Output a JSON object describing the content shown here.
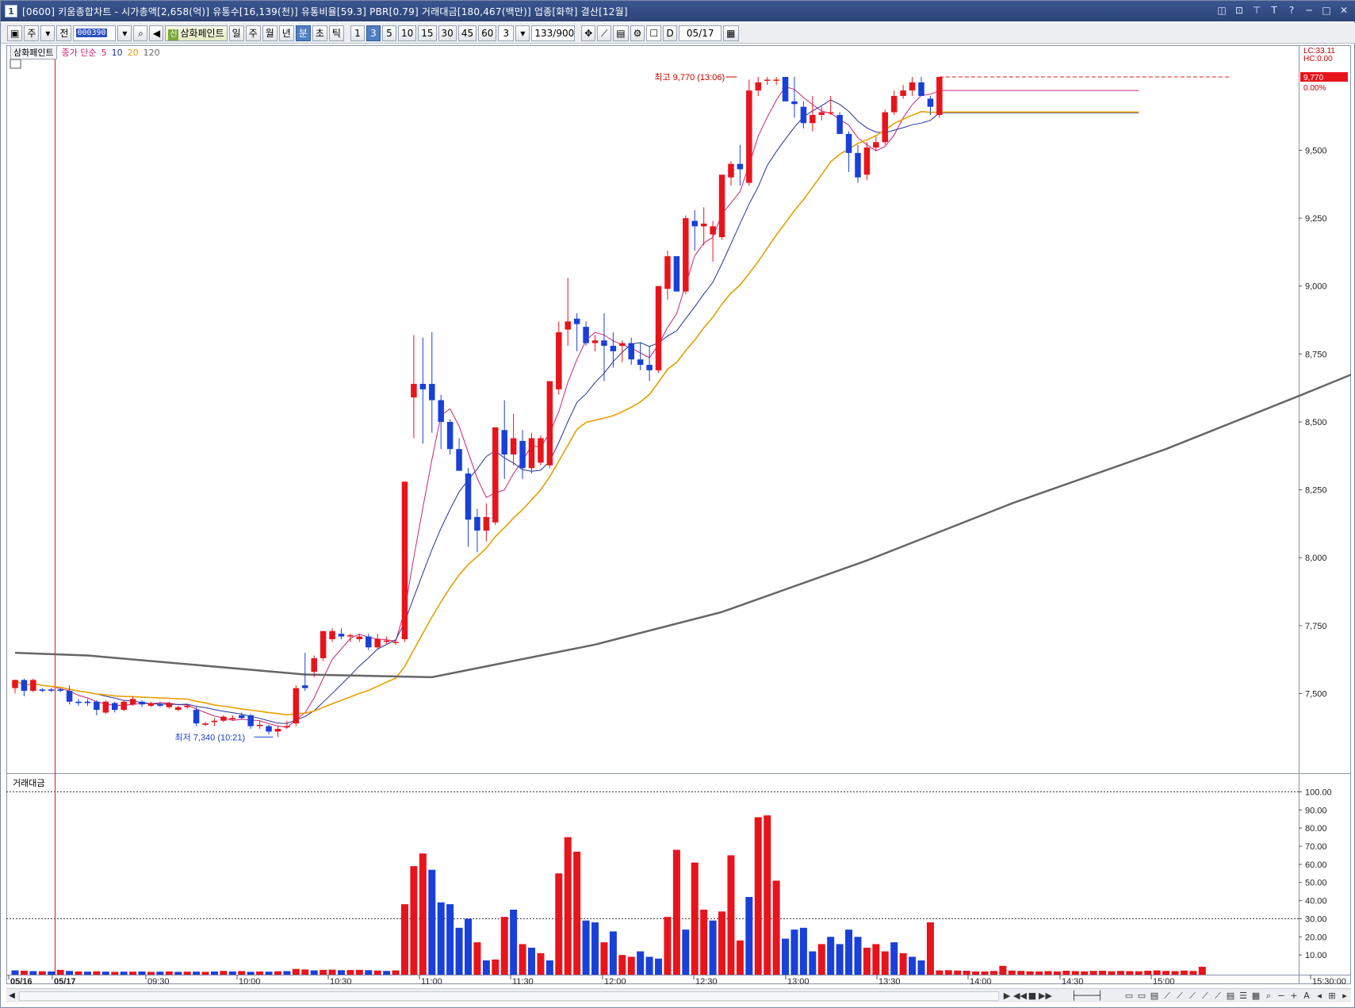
{
  "window": {
    "number": "1",
    "title": "[0600] 키움종합차트 - 시가총액[2,658(억)] 유통수[16,139(천)] 유통비율[59.3] PBR[0.79] 거래대금[180,467(백만)] 업종[화학] 결산[12월]",
    "controls": [
      "◫",
      "⊡",
      "⊤",
      "T",
      "?",
      "─",
      "□",
      "✕"
    ]
  },
  "toolbar": {
    "market": "주",
    "whole": "전",
    "code": "000390",
    "stock_name": "삼화페인트",
    "stock_badge": "신",
    "periods": [
      "일",
      "주",
      "월",
      "년",
      "분",
      "초",
      "틱"
    ],
    "active_period": "분",
    "minutes": [
      "1",
      "3",
      "5",
      "10",
      "15",
      "30",
      "45",
      "60"
    ],
    "active_minute": "3",
    "interval": "3",
    "count": "133",
    "count_max": "/900",
    "date_toggle": "D",
    "date": "05/17"
  },
  "price_panel": {
    "name": "삼화페인트",
    "ma_label": "종가 단순",
    "ma_periods": [
      "5",
      "10",
      "20",
      "120"
    ],
    "ma_colors": [
      "#cc2277",
      "#223399",
      "#e8a000",
      "#666666"
    ],
    "lc_label": "LC:33.11",
    "hc_label": "HC:0.00",
    "last_price": "9,770",
    "last_change": "0.00%",
    "high_label": "최고 9,770 (13:06)",
    "low_label": "최저 7,340 (10:21)",
    "y_ticks": [
      "9,500",
      "9,250",
      "9,000",
      "8,750",
      "8,500",
      "8,250",
      "8,000",
      "7,750",
      "7,500"
    ]
  },
  "volume_panel": {
    "name": "거래대금",
    "y_ticks": [
      "100.00",
      "90.00",
      "80.00",
      "70.00",
      "60.00",
      "50.00",
      "40.00",
      "30.00",
      "20.00",
      "10.00"
    ]
  },
  "x_axis": {
    "labels": [
      "05/16",
      "05/17",
      "09:30",
      "10:00",
      "10:30",
      "11:00",
      "11:30",
      "12:00",
      "12:30",
      "13:00",
      "13:30",
      "14:00",
      "14:30",
      "15:00",
      "15:30:00"
    ]
  },
  "colors": {
    "up": "#e8141c",
    "down": "#1940d8",
    "ma5": "#cc2277",
    "ma10": "#223399",
    "ma20": "#e8a000",
    "ma120": "#666666"
  },
  "chart_data": {
    "type": "candlestick",
    "interval_minutes": 3,
    "x_labels": [
      "05/16",
      "05/17",
      "09:30",
      "10:00",
      "10:30",
      "11:00",
      "11:30",
      "12:00",
      "12:30",
      "13:00",
      "13:30",
      "14:00",
      "14:30",
      "15:00",
      "15:30:00"
    ],
    "y_range": [
      7300,
      9770
    ],
    "candles": [
      [
        7520,
        7550,
        7500,
        7550
      ],
      [
        7550,
        7555,
        7490,
        7510
      ],
      [
        7510,
        7555,
        7505,
        7550
      ],
      [
        7515,
        7520,
        7505,
        7510
      ],
      [
        7515,
        7520,
        7505,
        7510
      ],
      [
        7515,
        7520,
        7505,
        7510
      ],
      [
        7510,
        7530,
        7460,
        7470
      ],
      [
        7470,
        7480,
        7455,
        7465
      ],
      [
        7470,
        7480,
        7455,
        7465
      ],
      [
        7470,
        7475,
        7420,
        7440
      ],
      [
        7430,
        7475,
        7425,
        7470
      ],
      [
        7465,
        7470,
        7430,
        7440
      ],
      [
        7440,
        7475,
        7435,
        7470
      ],
      [
        7460,
        7490,
        7455,
        7480
      ],
      [
        7470,
        7475,
        7450,
        7460
      ],
      [
        7455,
        7470,
        7450,
        7465
      ],
      [
        7460,
        7470,
        7450,
        7455
      ],
      [
        7450,
        7470,
        7445,
        7465
      ],
      [
        7440,
        7455,
        7435,
        7450
      ],
      [
        7450,
        7460,
        7445,
        7455
      ],
      [
        7440,
        7450,
        7380,
        7390
      ],
      [
        7385,
        7395,
        7380,
        7390
      ],
      [
        7395,
        7410,
        7380,
        7400
      ],
      [
        7400,
        7420,
        7395,
        7415
      ],
      [
        7405,
        7420,
        7400,
        7410
      ],
      [
        7420,
        7430,
        7405,
        7410
      ],
      [
        7420,
        7425,
        7370,
        7380
      ],
      [
        7380,
        7400,
        7370,
        7385
      ],
      [
        7380,
        7385,
        7350,
        7360
      ],
      [
        7360,
        7380,
        7340,
        7370
      ],
      [
        7380,
        7400,
        7370,
        7380
      ],
      [
        7390,
        7530,
        7380,
        7520
      ],
      [
        7530,
        7650,
        7510,
        7520
      ],
      [
        7580,
        7640,
        7560,
        7630
      ],
      [
        7630,
        7720,
        7620,
        7730
      ],
      [
        7700,
        7740,
        7690,
        7730
      ],
      [
        7720,
        7740,
        7700,
        7710
      ],
      [
        7710,
        7720,
        7690,
        7715
      ],
      [
        7700,
        7720,
        7690,
        7710
      ],
      [
        7710,
        7720,
        7660,
        7670
      ],
      [
        7670,
        7720,
        7665,
        7700
      ],
      [
        7690,
        7710,
        7680,
        7695
      ],
      [
        7690,
        7700,
        7680,
        7690
      ],
      [
        7700,
        8280,
        7690,
        8280
      ],
      [
        8590,
        8820,
        8440,
        8640
      ],
      [
        8640,
        8810,
        8420,
        8620
      ],
      [
        8640,
        8830,
        8460,
        8580
      ],
      [
        8580,
        8600,
        8400,
        8500
      ],
      [
        8500,
        8510,
        8380,
        8400
      ],
      [
        8400,
        8440,
        8320,
        8320
      ],
      [
        8310,
        8330,
        8040,
        8140
      ],
      [
        8150,
        8180,
        8020,
        8100
      ],
      [
        8100,
        8200,
        8060,
        8150
      ],
      [
        8130,
        8480,
        8120,
        8480
      ],
      [
        8470,
        8580,
        8290,
        8380
      ],
      [
        8380,
        8530,
        8340,
        8440
      ],
      [
        8430,
        8470,
        8290,
        8330
      ],
      [
        8330,
        8460,
        8310,
        8440
      ],
      [
        8350,
        8450,
        8340,
        8440
      ],
      [
        8340,
        8640,
        8330,
        8650
      ],
      [
        8620,
        8870,
        8600,
        8830
      ],
      [
        8840,
        9030,
        8780,
        8870
      ],
      [
        8880,
        8900,
        8760,
        8860
      ],
      [
        8850,
        8870,
        8780,
        8790
      ],
      [
        8790,
        8820,
        8760,
        8800
      ],
      [
        8800,
        8900,
        8650,
        8780
      ],
      [
        8780,
        8830,
        8700,
        8760
      ],
      [
        8780,
        8800,
        8720,
        8790
      ],
      [
        8790,
        8810,
        8710,
        8730
      ],
      [
        8730,
        8790,
        8690,
        8710
      ],
      [
        8710,
        8780,
        8650,
        8690
      ],
      [
        8690,
        9000,
        8680,
        9000
      ],
      [
        8990,
        9130,
        8950,
        9110
      ],
      [
        9110,
        9070,
        8980,
        8980
      ],
      [
        8980,
        9260,
        8970,
        9250
      ],
      [
        9240,
        9280,
        9130,
        9220
      ],
      [
        9220,
        9290,
        9150,
        9230
      ],
      [
        9190,
        9240,
        9090,
        9220
      ],
      [
        9180,
        9410,
        9170,
        9410
      ],
      [
        9400,
        9460,
        9370,
        9450
      ],
      [
        9450,
        9520,
        9370,
        9430
      ],
      [
        9380,
        9760,
        9370,
        9720
      ],
      [
        9720,
        9770,
        9700,
        9750
      ],
      [
        9760,
        9770,
        9740,
        9760
      ],
      [
        9760,
        9770,
        9740,
        9760
      ],
      [
        9770,
        9770,
        9680,
        9680
      ],
      [
        9680,
        9770,
        9620,
        9670
      ],
      [
        9660,
        9680,
        9580,
        9600
      ],
      [
        9600,
        9700,
        9570,
        9630
      ],
      [
        9630,
        9660,
        9610,
        9640
      ],
      [
        9640,
        9700,
        9630,
        9640
      ],
      [
        9630,
        9640,
        9560,
        9560
      ],
      [
        9560,
        9570,
        9420,
        9490
      ],
      [
        9490,
        9520,
        9380,
        9400
      ],
      [
        9410,
        9530,
        9390,
        9510
      ],
      [
        9510,
        9550,
        9500,
        9530
      ],
      [
        9530,
        9650,
        9520,
        9640
      ],
      [
        9640,
        9720,
        9630,
        9700
      ],
      [
        9700,
        9740,
        9690,
        9720
      ],
      [
        9720,
        9770,
        9700,
        9750
      ],
      [
        9750,
        9770,
        9700,
        9700
      ],
      [
        9690,
        9700,
        9630,
        9660
      ],
      [
        9630,
        9770,
        9620,
        9770
      ]
    ],
    "ma120": [
      [
        0,
        7650
      ],
      [
        8,
        7640
      ],
      [
        32,
        7570
      ],
      [
        46,
        7560
      ],
      [
        58,
        7640
      ],
      [
        64,
        7680
      ],
      [
        78,
        7800
      ],
      [
        94,
        7990
      ],
      [
        110,
        8200
      ],
      [
        127,
        8400
      ],
      [
        142,
        8600
      ],
      [
        153,
        8750
      ]
    ],
    "volume": [
      [
        0,
        1.5,
        "down"
      ],
      [
        1,
        1.3,
        "up"
      ],
      [
        2,
        1.1,
        "down"
      ],
      [
        3,
        1.0,
        "up"
      ],
      [
        4,
        0.9,
        "down"
      ],
      [
        5,
        1.8,
        "up"
      ],
      [
        6,
        1.2,
        "down"
      ],
      [
        7,
        0.9,
        "up"
      ],
      [
        8,
        0.8,
        "down"
      ],
      [
        9,
        1.0,
        "up"
      ],
      [
        10,
        0.8,
        "down"
      ],
      [
        11,
        0.7,
        "up"
      ],
      [
        12,
        0.8,
        "down"
      ],
      [
        13,
        0.8,
        "up"
      ],
      [
        14,
        0.9,
        "down"
      ],
      [
        15,
        0.7,
        "up"
      ],
      [
        16,
        0.8,
        "down"
      ],
      [
        17,
        0.9,
        "up"
      ],
      [
        18,
        0.7,
        "down"
      ],
      [
        19,
        0.8,
        "up"
      ],
      [
        20,
        0.8,
        "down"
      ],
      [
        21,
        0.7,
        "up"
      ],
      [
        22,
        0.9,
        "down"
      ],
      [
        23,
        1.2,
        "up"
      ],
      [
        24,
        0.9,
        "down"
      ],
      [
        25,
        1.1,
        "up"
      ],
      [
        26,
        0.7,
        "down"
      ],
      [
        27,
        0.9,
        "up"
      ],
      [
        28,
        0.8,
        "down"
      ],
      [
        29,
        1.0,
        "up"
      ],
      [
        30,
        1.1,
        "down"
      ],
      [
        31,
        2.3,
        "up"
      ],
      [
        32,
        2.0,
        "up"
      ],
      [
        33,
        1.5,
        "down"
      ],
      [
        34,
        1.8,
        "up"
      ],
      [
        35,
        1.9,
        "up"
      ],
      [
        36,
        1.6,
        "down"
      ],
      [
        37,
        1.7,
        "up"
      ],
      [
        38,
        1.8,
        "up"
      ],
      [
        39,
        1.6,
        "down"
      ],
      [
        40,
        1.4,
        "up"
      ],
      [
        41,
        1.2,
        "down"
      ],
      [
        42,
        1.5,
        "up"
      ],
      [
        43,
        38.0,
        "up"
      ],
      [
        44,
        59.0,
        "up"
      ],
      [
        45,
        66.0,
        "up"
      ],
      [
        46,
        57.0,
        "down"
      ],
      [
        47,
        39.0,
        "down"
      ],
      [
        48,
        38.0,
        "down"
      ],
      [
        49,
        25.0,
        "down"
      ],
      [
        50,
        30.0,
        "down"
      ],
      [
        51,
        17.0,
        "up"
      ],
      [
        52,
        7.0,
        "down"
      ],
      [
        53,
        7.5,
        "up"
      ],
      [
        54,
        31.0,
        "up"
      ],
      [
        55,
        35.0,
        "down"
      ],
      [
        56,
        16.0,
        "up"
      ],
      [
        57,
        14.0,
        "down"
      ],
      [
        58,
        11.0,
        "up"
      ],
      [
        59,
        7.0,
        "down"
      ],
      [
        60,
        55.0,
        "up"
      ],
      [
        61,
        75.0,
        "up"
      ],
      [
        62,
        67.0,
        "up"
      ],
      [
        63,
        29.0,
        "down"
      ],
      [
        64,
        28.0,
        "down"
      ],
      [
        65,
        17.0,
        "up"
      ],
      [
        66,
        23.0,
        "down"
      ],
      [
        67,
        10.0,
        "up"
      ],
      [
        68,
        9.0,
        "up"
      ],
      [
        69,
        12.0,
        "down"
      ],
      [
        70,
        9.0,
        "down"
      ],
      [
        71,
        8.0,
        "down"
      ],
      [
        72,
        31.0,
        "up"
      ],
      [
        73,
        68.0,
        "up"
      ],
      [
        74,
        24.0,
        "down"
      ],
      [
        75,
        61.0,
        "up"
      ],
      [
        76,
        35.0,
        "up"
      ],
      [
        77,
        29.0,
        "down"
      ],
      [
        78,
        34.0,
        "up"
      ],
      [
        79,
        65.0,
        "up"
      ],
      [
        80,
        18.0,
        "up"
      ],
      [
        81,
        42.0,
        "down"
      ],
      [
        82,
        86.0,
        "up"
      ],
      [
        83,
        87.0,
        "up"
      ],
      [
        84,
        51.0,
        "up"
      ],
      [
        85,
        19.0,
        "down"
      ],
      [
        86,
        24.0,
        "down"
      ],
      [
        87,
        25.0,
        "down"
      ],
      [
        88,
        12.0,
        "down"
      ],
      [
        89,
        16.0,
        "up"
      ],
      [
        90,
        20.0,
        "down"
      ],
      [
        91,
        16.0,
        "down"
      ],
      [
        92,
        24.0,
        "down"
      ],
      [
        93,
        20.0,
        "down"
      ],
      [
        94,
        14.0,
        "up"
      ],
      [
        95,
        16.0,
        "up"
      ],
      [
        96,
        12.0,
        "up"
      ],
      [
        97,
        17.0,
        "down"
      ],
      [
        98,
        11.0,
        "up"
      ],
      [
        99,
        9.0,
        "down"
      ],
      [
        100,
        7.0,
        "down"
      ],
      [
        101,
        28.0,
        "up"
      ],
      [
        102,
        1.5,
        "up"
      ],
      [
        103,
        1.6,
        "up"
      ],
      [
        104,
        1.4,
        "up"
      ],
      [
        105,
        1.3,
        "up"
      ],
      [
        106,
        0.9,
        "up"
      ],
      [
        107,
        0.9,
        "up"
      ],
      [
        108,
        1.2,
        "up"
      ],
      [
        109,
        4.0,
        "up"
      ],
      [
        110,
        1.4,
        "up"
      ],
      [
        111,
        1.2,
        "up"
      ],
      [
        112,
        1.0,
        "up"
      ],
      [
        113,
        0.9,
        "up"
      ],
      [
        114,
        1.1,
        "up"
      ],
      [
        115,
        0.9,
        "up"
      ],
      [
        116,
        1.3,
        "up"
      ],
      [
        117,
        1.1,
        "up"
      ],
      [
        118,
        0.9,
        "up"
      ],
      [
        119,
        1.2,
        "up"
      ],
      [
        120,
        1.3,
        "up"
      ],
      [
        121,
        1.0,
        "up"
      ],
      [
        122,
        1.2,
        "up"
      ],
      [
        123,
        1.1,
        "up"
      ],
      [
        124,
        1.0,
        "up"
      ],
      [
        125,
        1.3,
        "up"
      ],
      [
        126,
        1.5,
        "up"
      ],
      [
        127,
        1.2,
        "up"
      ],
      [
        128,
        1.1,
        "up"
      ],
      [
        129,
        1.4,
        "up"
      ],
      [
        130,
        1.2,
        "up"
      ],
      [
        131,
        3.5,
        "up"
      ]
    ]
  }
}
